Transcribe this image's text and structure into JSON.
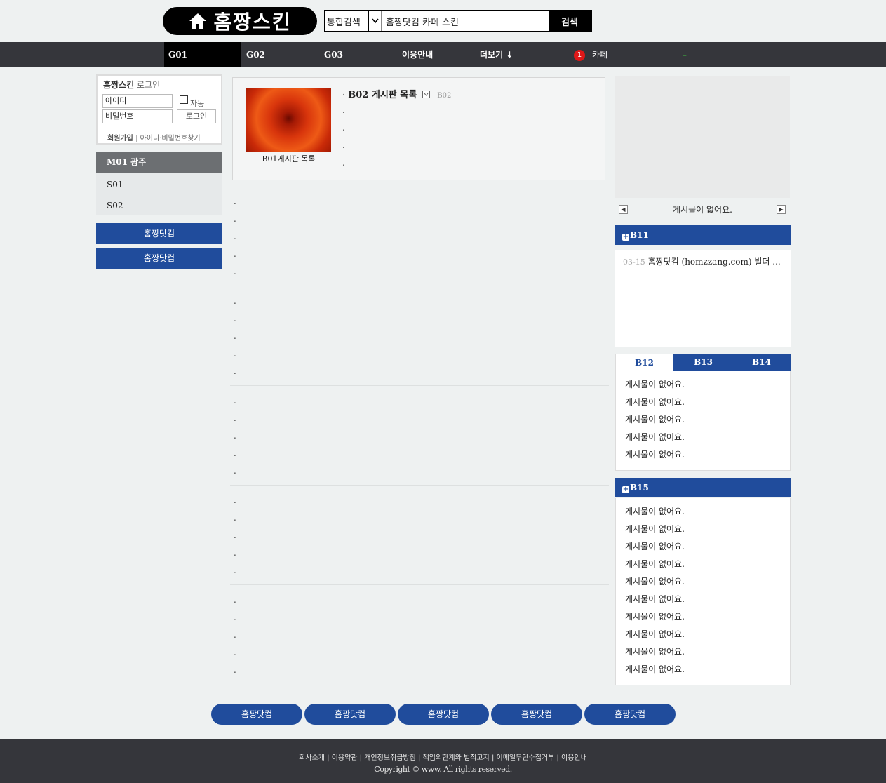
{
  "header": {
    "logo_text": "홈짱스킨",
    "search": {
      "select_value": "통합검색",
      "input_value": "홈짱닷컴 카페 스킨",
      "button_label": "검색"
    }
  },
  "nav": {
    "items": [
      "G01",
      "G02",
      "G03",
      "이용안내",
      "더보기 ↓"
    ],
    "cafe_badge": "1",
    "cafe_label": "카페",
    "dash": "–"
  },
  "login": {
    "title_bold": "홈짱스킨",
    "title_rest": "로그인",
    "id_placeholder": "아이디",
    "pw_placeholder": "비밀번호",
    "auto_label": "자동",
    "login_button": "로그인",
    "signup_link": "회원가입",
    "find_link": "아이디·비밀번호찾기"
  },
  "side_menu": {
    "title": "M01 광주",
    "subs": [
      "S01",
      "S02"
    ]
  },
  "side_buttons": [
    "홈짱닷컴",
    "홈짱닷컴"
  ],
  "feature": {
    "image_caption": "B01게시판 목록",
    "list_title": "B02 게시판 목록",
    "list_sub": "B02"
  },
  "slider": {
    "message": "게시물이 없어요."
  },
  "b11": {
    "title": "B11",
    "items": [
      {
        "date": "03-15",
        "text": "홈짱닷컴 (homzzang.com) 빌더 ..."
      }
    ]
  },
  "tabs": {
    "labels": [
      "B12",
      "B13",
      "B14"
    ],
    "items": [
      "게시물이 없어요.",
      "게시물이 없어요.",
      "게시물이 없어요.",
      "게시물이 없어요.",
      "게시물이 없어요."
    ]
  },
  "b15": {
    "title": "B15",
    "items": [
      "게시물이 없어요.",
      "게시물이 없어요.",
      "게시물이 없어요.",
      "게시물이 없어요.",
      "게시물이 없어요.",
      "게시물이 없어요.",
      "게시물이 없어요.",
      "게시물이 없어요.",
      "게시물이 없어요.",
      "게시물이 없어요."
    ]
  },
  "bottom_buttons": [
    "홈짱닷컴",
    "홈짱닷컴",
    "홈짱닷컴",
    "홈짱닷컴",
    "홈짱닷컴"
  ],
  "footer": {
    "links": [
      "회사소개",
      "이용약관",
      "개인정보취급방침",
      "책임의한계와 법적고지",
      "이메일무단수집거부",
      "이용안내"
    ],
    "copyright": "Copyright © www. All rights reserved."
  }
}
